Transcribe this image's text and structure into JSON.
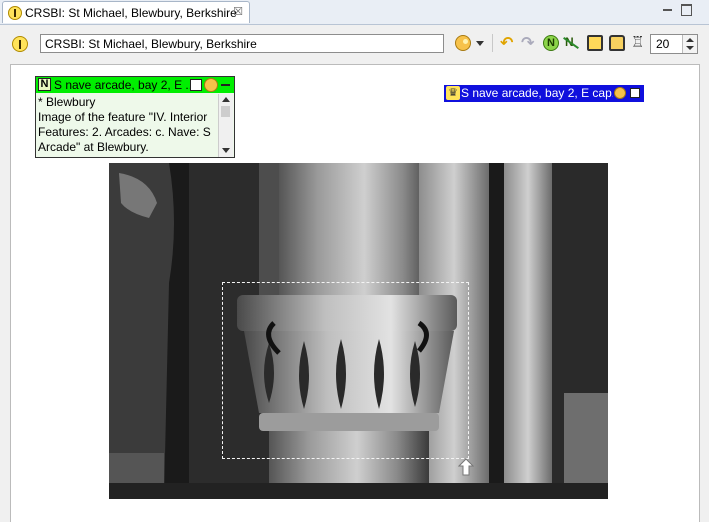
{
  "tab": {
    "title": "CRSBI: St Michael, Blewbury, Berkshire",
    "close": "☒"
  },
  "toolbar": {
    "title_value": "CRSBI: St Michael, Blewbury, Berkshire",
    "zoom_value": "20"
  },
  "annotation": {
    "title": "S nave arcade, bay 2, E ...",
    "badge": "N",
    "lines": [
      "* Blewbury",
      "Image of the feature \"IV. Interior",
      "Features: 2. Arcades: c. Nave: S",
      "Arcade\" at Blewbury."
    ]
  },
  "tag": {
    "title": "S nave arcade, bay 2, E cap..."
  },
  "colors": {
    "annotation_header": "#00ee00",
    "annotation_body": "#eef9ea",
    "tag_background": "#1010dd"
  }
}
